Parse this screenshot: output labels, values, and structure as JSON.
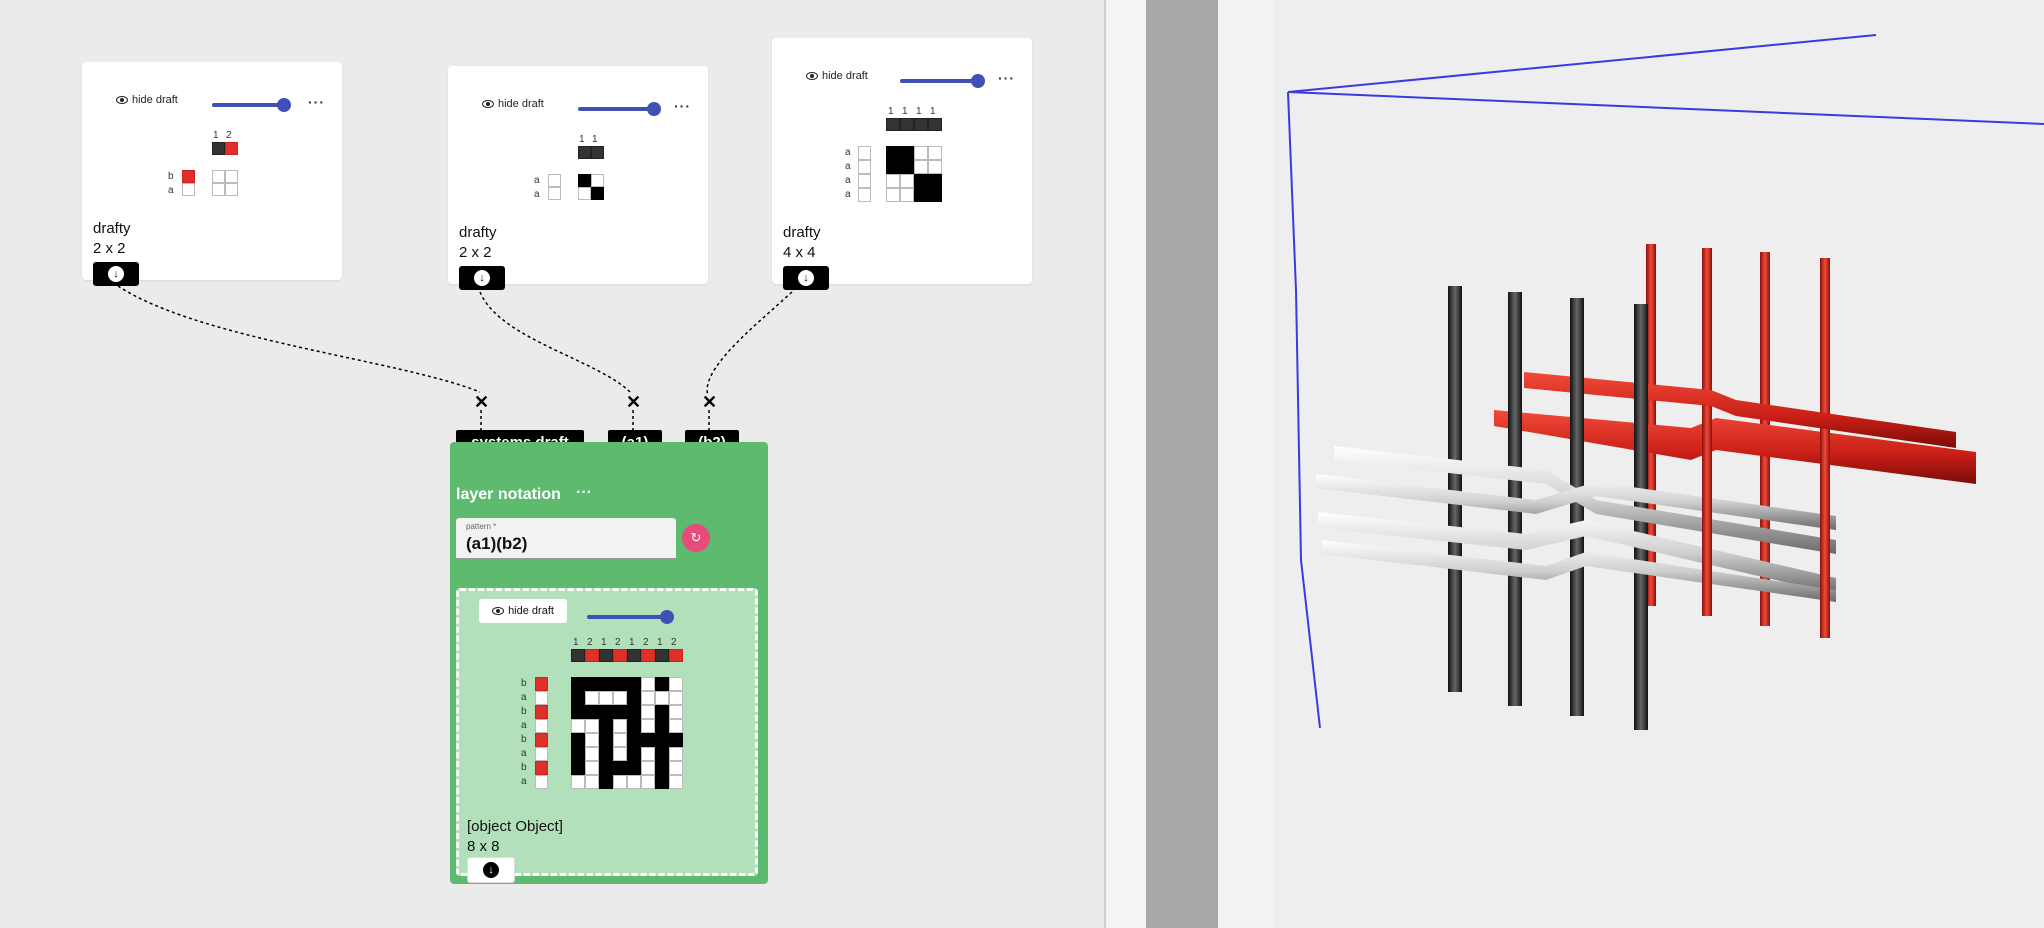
{
  "colors": {
    "accent_blue": "#3f51b5",
    "operation_green": "#5eba6f",
    "inner_green": "#b2e0bb",
    "refresh_pink": "#e84a7a",
    "red_yarn": "#e0302a",
    "frame_blue": "#3a3ae0"
  },
  "common": {
    "hide_draft_label": "hide draft",
    "more_label": "···",
    "download_icon": "download-icon"
  },
  "drafts": [
    {
      "name": "drafty",
      "size": "2 x 2",
      "warp_numbers": [
        "1",
        "2"
      ],
      "warp_colors": [
        "d",
        "r"
      ],
      "weft_labels": [
        "b",
        "a"
      ],
      "weft_colors": [
        "r",
        ""
      ],
      "cells": [
        [
          0,
          0
        ],
        [
          0,
          0
        ]
      ]
    },
    {
      "name": "drafty",
      "size": "2 x 2",
      "warp_numbers": [
        "1",
        "1"
      ],
      "warp_colors": [
        "d",
        "d"
      ],
      "weft_labels": [
        "a",
        "a"
      ],
      "weft_colors": [
        "",
        ""
      ],
      "cells": [
        [
          1,
          0
        ],
        [
          0,
          1
        ]
      ]
    },
    {
      "name": "drafty",
      "size": "4 x 4",
      "warp_numbers": [
        "1",
        "1",
        "1",
        "1"
      ],
      "warp_colors": [
        "d",
        "d",
        "d",
        "d"
      ],
      "weft_labels": [
        "a",
        "a",
        "a",
        "a"
      ],
      "weft_colors": [
        "",
        "",
        "",
        ""
      ],
      "cells": [
        [
          1,
          1,
          0,
          0
        ],
        [
          1,
          1,
          0,
          0
        ],
        [
          0,
          0,
          1,
          1
        ],
        [
          0,
          0,
          1,
          1
        ]
      ]
    }
  ],
  "operation": {
    "inputs": [
      "systems draft",
      "(a1)",
      "(b2)"
    ],
    "title": "layer notation",
    "pattern_label": "pattern *",
    "pattern_value": "(a1)(b2)",
    "refresh_icon": "refresh-icon",
    "result": {
      "name": "[object Object]",
      "size": "8 x 8",
      "warp_numbers": [
        "1",
        "2",
        "1",
        "2",
        "1",
        "2",
        "1",
        "2"
      ],
      "warp_colors": [
        "d",
        "r",
        "d",
        "r",
        "d",
        "r",
        "d",
        "r"
      ],
      "weft_labels": [
        "b",
        "a",
        "b",
        "a",
        "b",
        "a",
        "b",
        "a"
      ],
      "weft_colors": [
        "r",
        "",
        "r",
        "",
        "r",
        "",
        "r",
        ""
      ],
      "cells": [
        [
          1,
          1,
          1,
          1,
          1,
          0,
          1,
          0
        ],
        [
          1,
          0,
          0,
          0,
          1,
          0,
          0,
          0
        ],
        [
          1,
          1,
          1,
          1,
          1,
          0,
          1,
          0
        ],
        [
          0,
          0,
          1,
          0,
          1,
          0,
          1,
          0
        ],
        [
          1,
          0,
          1,
          0,
          1,
          1,
          1,
          1
        ],
        [
          1,
          0,
          1,
          0,
          1,
          0,
          1,
          0
        ],
        [
          1,
          0,
          1,
          1,
          1,
          0,
          1,
          0
        ],
        [
          0,
          0,
          1,
          0,
          0,
          0,
          1,
          0
        ]
      ]
    }
  }
}
